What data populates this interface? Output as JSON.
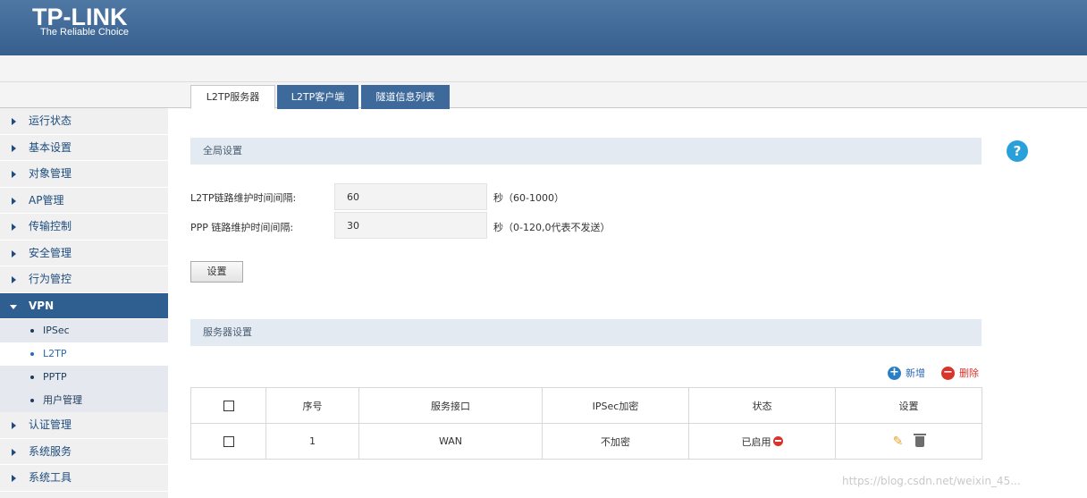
{
  "brand": {
    "logo": "TP-LINK",
    "tagline": "The Reliable Choice"
  },
  "tabs": [
    {
      "label": "L2TP服务器",
      "active": true
    },
    {
      "label": "L2TP客户端",
      "active": false
    },
    {
      "label": "隧道信息列表",
      "active": false
    }
  ],
  "sidebar": {
    "items": [
      {
        "label": "运行状态"
      },
      {
        "label": "基本设置"
      },
      {
        "label": "对象管理"
      },
      {
        "label": "AP管理"
      },
      {
        "label": "传输控制"
      },
      {
        "label": "安全管理"
      },
      {
        "label": "行为管控"
      },
      {
        "label": "VPN",
        "expanded": true
      },
      {
        "label": "认证管理"
      },
      {
        "label": "系统服务"
      },
      {
        "label": "系统工具"
      }
    ],
    "vpn_subitems": [
      {
        "label": "IPSec"
      },
      {
        "label": "L2TP",
        "active": true
      },
      {
        "label": "PPTP"
      },
      {
        "label": "用户管理"
      }
    ]
  },
  "global_settings": {
    "title": "全局设置",
    "l2tp_label": "L2TP链路维护时间间隔:",
    "l2tp_value": "60",
    "l2tp_hint": "秒（60-1000）",
    "ppp_label": "PPP 链路维护时间间隔:",
    "ppp_value": "30",
    "ppp_hint": "秒（0-120,0代表不发送）",
    "apply_button": "设置"
  },
  "help_icon": "?",
  "server_settings": {
    "title": "服务器设置",
    "add_label": "新增",
    "delete_label": "删除",
    "columns": [
      "序号",
      "服务接口",
      "IPSec加密",
      "状态",
      "设置"
    ],
    "rows": [
      {
        "index": "1",
        "interface": "WAN",
        "ipsec": "不加密",
        "status": "已启用"
      }
    ]
  },
  "watermark": "https://blog.csdn.net/weixin_45...",
  "colors": {
    "header": "#3e6a9b",
    "accent": "#2aa0da",
    "danger": "#d9342b",
    "sidebar_active": "#2f5f91"
  }
}
